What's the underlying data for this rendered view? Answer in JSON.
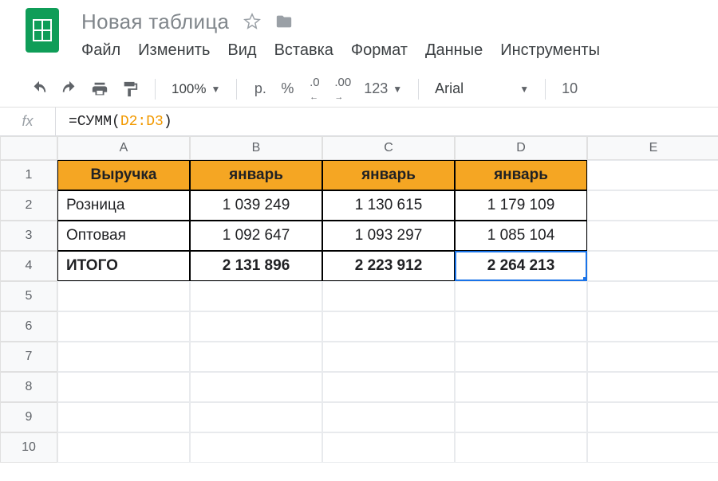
{
  "doc_title": "Новая таблица",
  "menus": [
    "Файл",
    "Изменить",
    "Вид",
    "Вставка",
    "Формат",
    "Данные",
    "Инструменты"
  ],
  "toolbar": {
    "zoom": "100%",
    "currency": "р.",
    "percent": "%",
    "dec_less": ".0",
    "dec_more": ".00",
    "num_fmt": "123",
    "font": "Arial",
    "font_size": "10"
  },
  "formula": {
    "prefix": "=СУММ(",
    "range": "D2:D3",
    "suffix": ")"
  },
  "columns": [
    "A",
    "B",
    "C",
    "D",
    "E"
  ],
  "rows": [
    "1",
    "2",
    "3",
    "4",
    "5",
    "6",
    "7",
    "8",
    "9",
    "10"
  ],
  "table": {
    "headers": [
      "Выручка",
      "январь",
      "январь",
      "январь"
    ],
    "r2": [
      "Розница",
      "1 039 249",
      "1 130 615",
      "1 179 109"
    ],
    "r3": [
      "Оптовая",
      "1 092 647",
      "1 093 297",
      "1 085 104"
    ],
    "r4": [
      "ИТОГО",
      "2 131 896",
      "2 223 912",
      "2 264 213"
    ]
  },
  "chart_data": {
    "type": "table",
    "title": "Выручка",
    "columns": [
      "январь",
      "январь",
      "январь"
    ],
    "rows": [
      {
        "name": "Розница",
        "values": [
          1039249,
          1130615,
          1179109
        ]
      },
      {
        "name": "Оптовая",
        "values": [
          1092647,
          1093297,
          1085104
        ]
      },
      {
        "name": "ИТОГО",
        "values": [
          2131896,
          2223912,
          2264213
        ]
      }
    ]
  }
}
